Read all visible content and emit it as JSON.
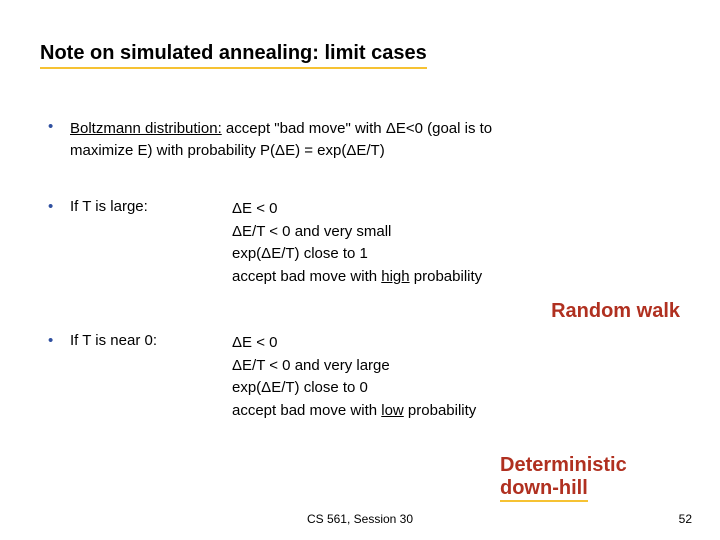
{
  "title": "Note on simulated annealing: limit cases",
  "bullet1": {
    "term": "Boltzmann distribution:",
    "rest1": " accept \"bad move\" with ΔE<0 (goal is to",
    "rest2": "maximize E) with probability P(ΔE) = exp(ΔE/T)"
  },
  "large": {
    "label": "If T is large:",
    "l1": "ΔE < 0",
    "l2": "ΔE/T < 0 and very small",
    "l3": "exp(ΔE/T) close to 1",
    "l4a": "accept bad move with ",
    "l4u": "high",
    "l4b": " probability"
  },
  "label_random": "Random walk",
  "near0": {
    "label": "If T is near 0:",
    "l1": "ΔE < 0",
    "l2": "ΔE/T < 0 and very large",
    "l3": "exp(ΔE/T) close to 0",
    "l4a": "accept bad move with ",
    "l4u": "low",
    "l4b": " probability"
  },
  "label_downhill_1": "Deterministic",
  "label_downhill_2": "down-hill",
  "footer_center": "CS 561,  Session 30",
  "footer_right": "52"
}
